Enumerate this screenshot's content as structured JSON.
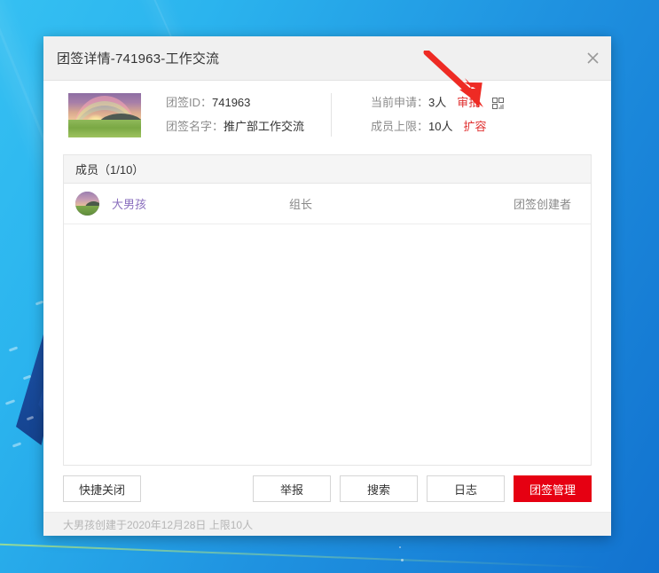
{
  "window": {
    "title": "团签详情-741963-工作交流",
    "close_icon": "close-icon"
  },
  "info": {
    "thumbnail_icon": "group-cover-image",
    "left_rows": [
      {
        "label": "团签ID：",
        "value": "741963"
      },
      {
        "label": "团签名字：",
        "value": "推广部工作交流"
      }
    ],
    "right_rows": [
      {
        "label": "当前申请：",
        "value": "3人",
        "link": "审批",
        "icon": "qr-code-icon"
      },
      {
        "label": "成员上限：",
        "value": "10人",
        "link": "扩容",
        "icon": ""
      }
    ]
  },
  "members": {
    "header": "成员（1/10）",
    "rows": [
      {
        "avatar": "member-avatar-image",
        "name": "大男孩",
        "role": "组长",
        "tag": "团签创建者"
      }
    ]
  },
  "buttons": {
    "quick_close": "快捷关闭",
    "report": "举报",
    "search": "搜索",
    "log": "日志",
    "manage": "团签管理"
  },
  "status": {
    "text": "大男孩创建于2020年12月28日  上限10人"
  },
  "colors": {
    "accent_red": "#e60012",
    "link_red": "#e03131",
    "member_name": "#8a6fbe",
    "desktop_blue": "#1f92e0"
  },
  "annotation": {
    "arrow_icon": "red-arrow-icon",
    "arrow_color": "#ee2b24",
    "points_to": "审批"
  }
}
